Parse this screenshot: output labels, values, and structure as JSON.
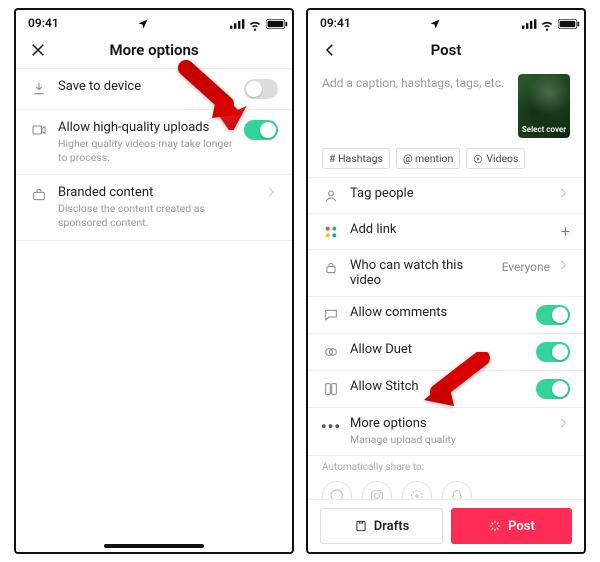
{
  "status": {
    "time": "09:41",
    "signal": "signal",
    "wifi": "wifi",
    "battery": "battery"
  },
  "left": {
    "title": "More options",
    "save_to_device": {
      "label": "Save to device",
      "on": false
    },
    "hq_uploads": {
      "label": "Allow high-quality uploads",
      "sub": "Higher quality videos may take longer to process.",
      "on": true
    },
    "branded": {
      "label": "Branded content",
      "sub": "Disclose the content created as sponsored content."
    }
  },
  "right": {
    "title": "Post",
    "caption_placeholder": "Add a caption, hashtags, tags, etc.",
    "cover_label": "Select cover",
    "chips": {
      "hashtags": "# Hashtags",
      "mention": "@ mention",
      "videos": "Videos"
    },
    "tag_people": "Tag people",
    "add_link": "Add link",
    "who_watch": {
      "label": "Who can watch this video",
      "value": "Everyone"
    },
    "allow_comments": {
      "label": "Allow comments",
      "on": true
    },
    "allow_duet": {
      "label": "Allow Duet",
      "on": true
    },
    "allow_stitch": {
      "label": "Allow Stitch",
      "on": true
    },
    "more_options": {
      "label": "More options",
      "sub": "Manage upload quality"
    },
    "share_hint": "Automatically share to:",
    "drafts": "Drafts",
    "post": "Post"
  }
}
